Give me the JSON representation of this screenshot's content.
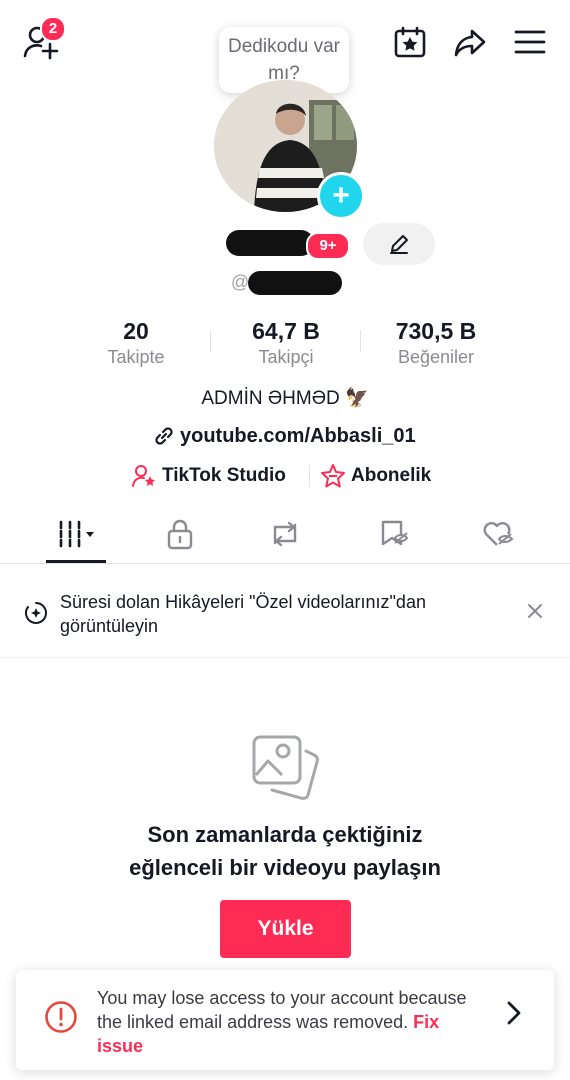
{
  "header": {
    "friends_badge": "2",
    "tooltip": "Dedikodu var mı?"
  },
  "profile": {
    "name_badge": "9+",
    "handle_prefix": "@",
    "bio": "ADMİN ƏHMƏD 🦅",
    "link": "youtube.com/Abbasli_01",
    "studio_label": "TikTok Studio",
    "subscription_label": "Abonelik"
  },
  "stats": {
    "following": {
      "value": "20",
      "label": "Takipte"
    },
    "followers": {
      "value": "64,7 B",
      "label": "Takipçi"
    },
    "likes": {
      "value": "730,5 B",
      "label": "Beğeniler"
    }
  },
  "tabs": [
    "videos-grid",
    "private",
    "reposts",
    "saved",
    "liked"
  ],
  "banner": {
    "text": "Süresi dolan Hikâyeleri \"Özel videolarınız\"dan görüntüleyin"
  },
  "empty_state": {
    "line1": "Son zamanlarda çektiğiniz",
    "line2": "eğlenceli bir videoyu paylaşın",
    "button": "Yükle"
  },
  "toast": {
    "text": "You may lose access to your account because the linked email address was removed.",
    "action": "Fix issue"
  },
  "colors": {
    "accent": "#fe2c55",
    "cyan": "#20d5ec",
    "text": "#161823",
    "muted": "#8a8b91"
  }
}
